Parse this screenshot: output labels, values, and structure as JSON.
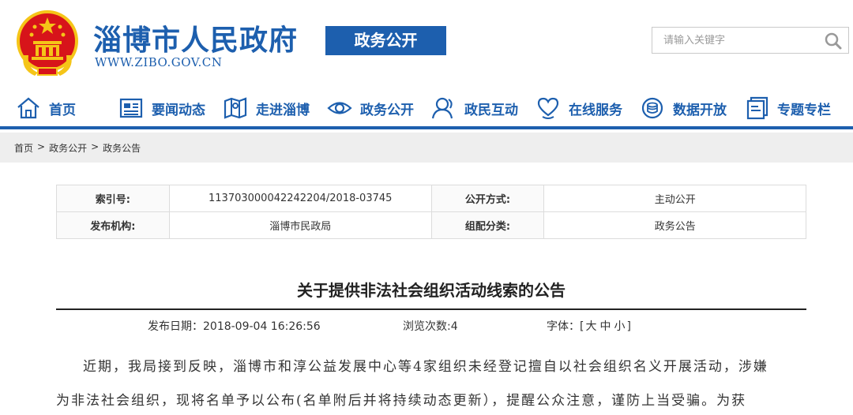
{
  "header": {
    "title": "淄博市人民政府",
    "url": "WWW.ZIBO.GOV.CN",
    "section": "政务公开",
    "search_placeholder": "请输入关键字"
  },
  "nav": [
    {
      "label": "首页",
      "icon": "home-icon"
    },
    {
      "label": "要闻动态",
      "icon": "news-icon"
    },
    {
      "label": "走进淄博",
      "icon": "map-icon"
    },
    {
      "label": "政务公开",
      "icon": "eye-icon"
    },
    {
      "label": "政民互动",
      "icon": "user-icon"
    },
    {
      "label": "在线服务",
      "icon": "heart-hand-icon"
    },
    {
      "label": "数据开放",
      "icon": "data-icon"
    },
    {
      "label": "专题专栏",
      "icon": "document-icon"
    }
  ],
  "breadcrumb": [
    "首页",
    "政务公开",
    "政务公告"
  ],
  "breadcrumb_separator": ">",
  "info": {
    "index_label": "索引号:",
    "index_value": "113703000042242204/2018-03745",
    "disclosure_label": "公开方式:",
    "disclosure_value": "主动公开",
    "publisher_label": "发布机构:",
    "publisher_value": "淄博市民政局",
    "category_label": "组配分类:",
    "category_value": "政务公告"
  },
  "article": {
    "title": "关于提供非法社会组织活动线索的公告",
    "publish_date": "发布日期：2018-09-04 16:26:56",
    "views": "浏览次数:4",
    "font_label": "字体：",
    "font_open": "[",
    "font_large": "大",
    "font_medium": "中",
    "font_small": "小",
    "font_close": "]",
    "para1_line1": "近期，我局接到反映，淄博市和淳公益发展中心等4家组织未经登记擅自以社会组织名义开展活动，涉嫌",
    "para1_line2": "为非法社会组织，现将名单予以公布(名单附后并将持续动态更新），提醒公众注意，谨防上当受骗。为获"
  },
  "colors": {
    "brand": "#1d5fae",
    "emblem_red": "#d7141a",
    "emblem_gold": "#f5c518"
  }
}
